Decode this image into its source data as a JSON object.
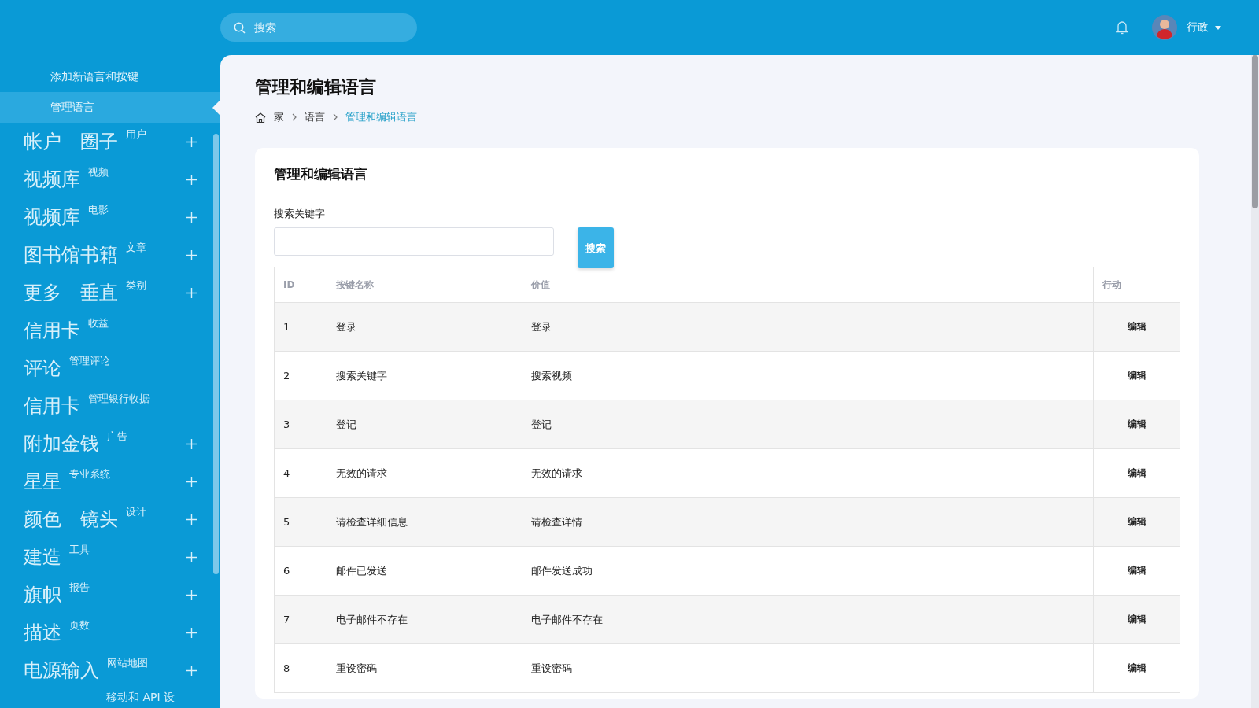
{
  "topbar": {
    "search": {
      "placeholder": "搜索"
    },
    "user": {
      "name": "行政"
    }
  },
  "sidebar": {
    "subitems": [
      {
        "label": "添加新语言和按键",
        "selected": false
      },
      {
        "label": "管理语言",
        "selected": true
      }
    ],
    "items": [
      {
        "label": "帐户 圈子",
        "note": "用户",
        "expandable": true
      },
      {
        "label": "视频库",
        "note": "视频",
        "expandable": true
      },
      {
        "label": "视频库",
        "note": "电影",
        "expandable": true
      },
      {
        "label": "图书馆书籍",
        "note": "文章",
        "expandable": true
      },
      {
        "label": "更多 垂直",
        "note": "类别",
        "expandable": true
      },
      {
        "label": "信用卡",
        "note": "收益",
        "expandable": false
      },
      {
        "label": "评论",
        "note": "管理评论",
        "expandable": false
      },
      {
        "label": "信用卡",
        "note": "管理银行收据",
        "expandable": false
      },
      {
        "label": "附加金钱",
        "note": "广告",
        "expandable": true
      },
      {
        "label": "星星",
        "note": "专业系统",
        "expandable": true
      },
      {
        "label": "颜色 镜头",
        "note": "设计",
        "expandable": true
      },
      {
        "label": "建造",
        "note": "工具",
        "expandable": true
      },
      {
        "label": "旗帜",
        "note": "报告",
        "expandable": true
      },
      {
        "label": "描述",
        "note": "页数",
        "expandable": true
      },
      {
        "label": "电源输入",
        "note": "网站地图",
        "expandable": true
      }
    ],
    "footer_item": "移动和 API 设"
  },
  "page": {
    "title": "管理和编辑语言",
    "breadcrumb": [
      {
        "label": "家",
        "current": false
      },
      {
        "label": "语言",
        "current": false
      },
      {
        "label": "管理和编辑语言",
        "current": true
      }
    ],
    "card": {
      "title": "管理和编辑语言",
      "search_label": "搜索关键字",
      "search_button": "搜索",
      "table": {
        "columns": [
          "ID",
          "按键名称",
          "价值",
          "行动"
        ],
        "rows": [
          {
            "id": "1",
            "key": "登录",
            "value": "登录",
            "action": "编辑"
          },
          {
            "id": "2",
            "key": "搜索关键字",
            "value": "搜索视频",
            "action": "编辑"
          },
          {
            "id": "3",
            "key": "登记",
            "value": "登记",
            "action": "编辑"
          },
          {
            "id": "4",
            "key": "无效的请求",
            "value": "无效的请求",
            "action": "编辑"
          },
          {
            "id": "5",
            "key": "请检查详细信息",
            "value": "请检查详情",
            "action": "编辑"
          },
          {
            "id": "6",
            "key": "邮件已发送",
            "value": "邮件发送成功",
            "action": "编辑"
          },
          {
            "id": "7",
            "key": "电子邮件不存在",
            "value": "电子邮件不存在",
            "action": "编辑"
          },
          {
            "id": "8",
            "key": "重设密码",
            "value": "重设密码",
            "action": "编辑"
          }
        ]
      }
    }
  }
}
